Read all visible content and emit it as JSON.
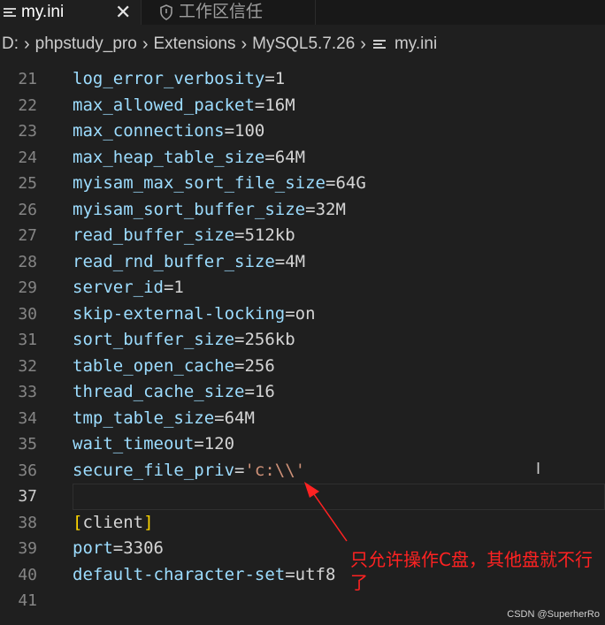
{
  "tabs": [
    {
      "label": "my.ini",
      "active": true,
      "icon": "lines-icon",
      "close": "✕"
    },
    {
      "label": "工作区信任",
      "active": false,
      "icon": "shield-icon"
    }
  ],
  "breadcrumb": [
    "D:",
    "phpstudy_pro",
    "Extensions",
    "MySQL5.7.26",
    "my.ini"
  ],
  "editor": {
    "lines": [
      {
        "num": "21",
        "key": "log_error_verbosity",
        "value": "1"
      },
      {
        "num": "22",
        "key": "max_allowed_packet",
        "value": "16M"
      },
      {
        "num": "23",
        "key": "max_connections",
        "value": "100"
      },
      {
        "num": "24",
        "key": "max_heap_table_size",
        "value": "64M"
      },
      {
        "num": "25",
        "key": "myisam_max_sort_file_size",
        "value": "64G"
      },
      {
        "num": "26",
        "key": "myisam_sort_buffer_size",
        "value": "32M"
      },
      {
        "num": "27",
        "key": "read_buffer_size",
        "value": "512kb"
      },
      {
        "num": "28",
        "key": "read_rnd_buffer_size",
        "value": "4M"
      },
      {
        "num": "29",
        "key": "server_id",
        "value": "1"
      },
      {
        "num": "30",
        "key": "skip-external-locking",
        "value": "on"
      },
      {
        "num": "31",
        "key": "sort_buffer_size",
        "value": "256kb"
      },
      {
        "num": "32",
        "key": "table_open_cache",
        "value": "256"
      },
      {
        "num": "33",
        "key": "thread_cache_size",
        "value": "16"
      },
      {
        "num": "34",
        "key": "tmp_table_size",
        "value": "64M"
      },
      {
        "num": "35",
        "key": "wait_timeout",
        "value": "120"
      },
      {
        "num": "36",
        "key": "secure_file_priv",
        "value": "'c:\\\\'",
        "string": true
      },
      {
        "num": "37",
        "key": "",
        "value": "",
        "current": true
      },
      {
        "num": "38",
        "section": "client"
      },
      {
        "num": "39",
        "key": "port",
        "value": "3306"
      },
      {
        "num": "40",
        "key": "default-character-set",
        "value": "utf8"
      },
      {
        "num": "41",
        "key": "",
        "value": ""
      }
    ]
  },
  "annotation": {
    "text": "只允许操作C盘，其他盘就不行了",
    "color": "#ff2222"
  },
  "watermark": "CSDN @SuperherRo",
  "cursor_glyph": "I"
}
